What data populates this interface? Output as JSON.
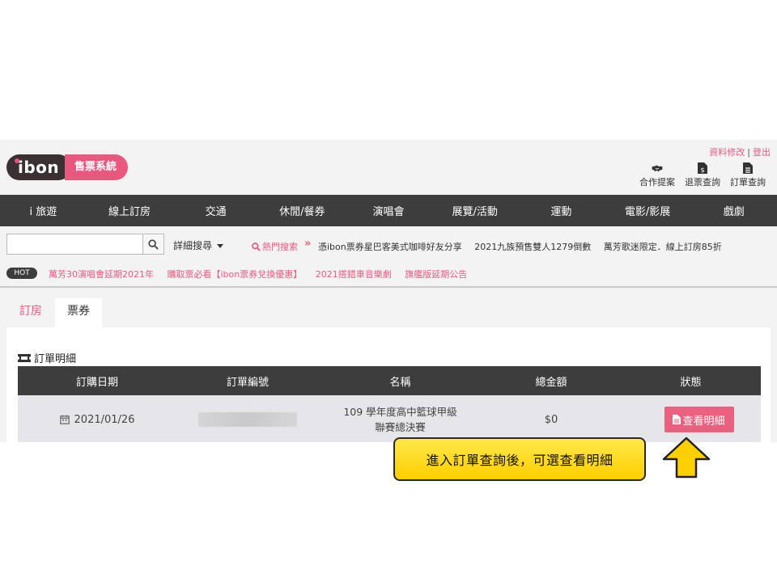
{
  "header": {
    "logo_brand": "ibon",
    "logo_system": "售票系統",
    "top_links": [
      "資料修改",
      "登出"
    ],
    "quick_links": [
      {
        "label": "合作提案",
        "icon": "handshake-icon"
      },
      {
        "label": "退票查詢",
        "icon": "refund-doc-icon"
      },
      {
        "label": "訂單查詢",
        "icon": "order-doc-icon"
      }
    ]
  },
  "nav": [
    "i 旅遊",
    "線上訂房",
    "交通",
    "休閒/餐券",
    "演唱會",
    "展覽/活動",
    "運動",
    "電影/影展",
    "戲劇"
  ],
  "search": {
    "placeholder": "",
    "advanced_label": "詳細搜尋",
    "hot_label": "熱門搜索",
    "hot_terms": [
      "憑ibon票券星巴客美式咖啡好友分享",
      "2021九族預售雙人1279倒數",
      "萬芳歌迷限定．線上訂房85折"
    ]
  },
  "news": {
    "badge": "HOT",
    "items": [
      "萬芳30演唱會延期2021年",
      "購取票必看【ibon票券兌換優惠】",
      "2021搭錯車音樂劇",
      "旗艦版延期公告"
    ]
  },
  "tabs": [
    "訂房",
    "票券"
  ],
  "orders": {
    "section_title": "訂單明細",
    "columns": [
      "訂購日期",
      "訂單編號",
      "名稱",
      "總金額",
      "狀態"
    ],
    "rows": [
      {
        "date": "2021/01/26",
        "order_no": "",
        "name": "109 學年度高中籃球甲級聯賽總決賽",
        "amount": "$0",
        "action": "查看明細"
      }
    ]
  },
  "annotation": {
    "text": "進入訂單查詢後，可選查看明細",
    "colors": {
      "fill": "#ffd700",
      "border": "#2a2a2a"
    }
  },
  "colors": {
    "accent": "#e9587f",
    "nav_bg": "#3d3d3d",
    "row_bg": "#e6e6ea"
  }
}
